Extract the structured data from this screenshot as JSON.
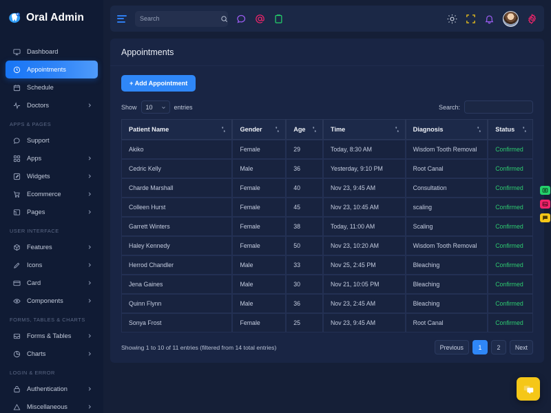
{
  "brand": {
    "name": "Oral Admin",
    "logo_icon": "tooth-logo-icon"
  },
  "sidebar": {
    "groups": [
      {
        "label": "",
        "items": [
          {
            "label": "Dashboard",
            "icon": "monitor-icon",
            "chevron": false,
            "active": false
          },
          {
            "label": "Appointments",
            "icon": "clock-icon",
            "chevron": false,
            "active": true
          },
          {
            "label": "Schedule",
            "icon": "calendar-icon",
            "chevron": false,
            "active": false
          },
          {
            "label": "Doctors",
            "icon": "activity-icon",
            "chevron": true,
            "active": false
          }
        ]
      },
      {
        "label": "APPS & PAGES",
        "items": [
          {
            "label": "Support",
            "icon": "message-circle-icon",
            "chevron": false,
            "active": false
          },
          {
            "label": "Apps",
            "icon": "grid-icon",
            "chevron": true,
            "active": false
          },
          {
            "label": "Widgets",
            "icon": "edit-square-icon",
            "chevron": true,
            "active": false
          },
          {
            "label": "Ecommerce",
            "icon": "shopping-cart-icon",
            "chevron": true,
            "active": false
          },
          {
            "label": "Pages",
            "icon": "layout-icon",
            "chevron": true,
            "active": false
          }
        ]
      },
      {
        "label": "USER INTERFACE",
        "items": [
          {
            "label": "Features",
            "icon": "box-icon",
            "chevron": true,
            "active": false
          },
          {
            "label": "Icons",
            "icon": "pen-icon",
            "chevron": true,
            "active": false
          },
          {
            "label": "Card",
            "icon": "card-icon",
            "chevron": true,
            "active": false
          },
          {
            "label": "Components",
            "icon": "eye-icon",
            "chevron": true,
            "active": false
          }
        ]
      },
      {
        "label": "FORMS, TABLES & CHARTS",
        "items": [
          {
            "label": "Forms & Tables",
            "icon": "inbox-icon",
            "chevron": true,
            "active": false
          },
          {
            "label": "Charts",
            "icon": "pie-chart-icon",
            "chevron": true,
            "active": false
          }
        ]
      },
      {
        "label": "LOGIN & ERROR",
        "items": [
          {
            "label": "Authentication",
            "icon": "lock-icon",
            "chevron": true,
            "active": false
          },
          {
            "label": "Miscellaneous",
            "icon": "alert-triangle-icon",
            "chevron": true,
            "active": false
          }
        ]
      }
    ]
  },
  "topbar": {
    "menu_icon": "hamburger-icon",
    "search": {
      "placeholder": "Search",
      "value": "",
      "icon": "search-icon"
    },
    "quick_icons": [
      {
        "name": "chat-icon",
        "color": "#9a5cf0"
      },
      {
        "name": "at-mention-icon",
        "color": "#f0246b"
      },
      {
        "name": "clipboard-icon",
        "color": "#24d16b"
      }
    ],
    "right_icons": [
      {
        "name": "sun-icon",
        "color": "#d6dce8"
      },
      {
        "name": "fullscreen-icon",
        "color": "#f5c718"
      },
      {
        "name": "bell-icon",
        "color": "#9a5cf0"
      }
    ],
    "avatar": "user-avatar",
    "settings_icon": {
      "name": "gear-icon",
      "color": "#f0246b"
    }
  },
  "page": {
    "title": "Appointments",
    "add_button": "+ Add Appointment",
    "show_label": "Show",
    "entries_label": "entries",
    "page_size": "10",
    "search_label": "Search:",
    "search_value": "",
    "search_placeholder": ""
  },
  "table": {
    "columns": [
      {
        "label": "Patient Name",
        "sortable": true
      },
      {
        "label": "Gender",
        "sortable": true
      },
      {
        "label": "Age",
        "sortable": true
      },
      {
        "label": "Time",
        "sortable": true
      },
      {
        "label": "Diagnosis",
        "sortable": true
      },
      {
        "label": "Status",
        "sortable": true
      }
    ],
    "rows": [
      [
        "Akiko",
        "Female",
        "29",
        "Today, 8:30 AM",
        "Wisdom Tooth Removal",
        "Confirmed"
      ],
      [
        "Cedric Kelly",
        "Male",
        "36",
        "Yesterday, 9:10 PM",
        "Root Canal",
        "Confirmed"
      ],
      [
        "Charde Marshall",
        "Female",
        "40",
        "Nov 23, 9:45 AM",
        "Consultation",
        "Confirmed"
      ],
      [
        "Colleen Hurst",
        "Female",
        "45",
        "Nov 23, 10:45 AM",
        "scaling",
        "Confirmed"
      ],
      [
        "Garrett Winters",
        "Female",
        "38",
        "Today, 11:00 AM",
        "Scaling",
        "Confirmed"
      ],
      [
        "Haley Kennedy",
        "Female",
        "50",
        "Nov 23, 10:20 AM",
        "Wisdom Tooth Removal",
        "Confirmed"
      ],
      [
        "Herrod Chandler",
        "Male",
        "33",
        "Nov 25, 2:45 PM",
        "Bleaching",
        "Confirmed"
      ],
      [
        "Jena Gaines",
        "Male",
        "30",
        "Nov 21, 10:05 PM",
        "Bleaching",
        "Confirmed"
      ],
      [
        "Quinn Flynn",
        "Male",
        "36",
        "Nov 23, 2:45 AM",
        "Bleaching",
        "Confirmed"
      ],
      [
        "Sonya Frost",
        "Female",
        "25",
        "Nov 23, 9:45 AM",
        "Root Canal",
        "Confirmed"
      ]
    ]
  },
  "footer": {
    "info": "Showing 1 to 10 of 11 entries (filtered from 14 total entries)",
    "previous": "Previous",
    "pages": [
      "1",
      "2"
    ],
    "active_page": "1",
    "next": "Next"
  },
  "edge_widgets": [
    {
      "name": "image-green-icon",
      "color": "#24d16b"
    },
    {
      "name": "image-pink-icon",
      "color": "#f0246b"
    },
    {
      "name": "chat-yellow-icon",
      "color": "#f5c718"
    }
  ],
  "fab": {
    "name": "chat-fab",
    "color": "#f5c718",
    "icon": "chat-bubbles-icon"
  },
  "colors": {
    "accent_blue": "#2f87f7",
    "status_green": "#2ecc71",
    "sidebar_bg": "#101b34",
    "page_bg": "#151f37",
    "card_bg": "#192544"
  }
}
